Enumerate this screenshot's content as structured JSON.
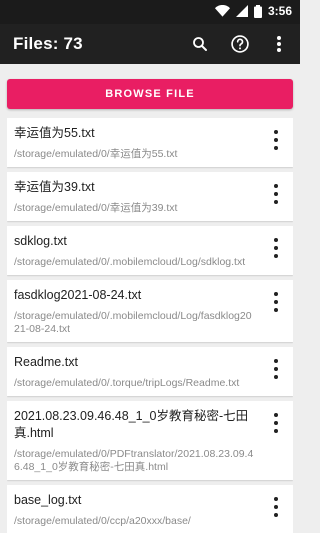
{
  "status": {
    "time": "3:56"
  },
  "appbar": {
    "title": "Files: 73",
    "icons": [
      "search-icon",
      "help-icon",
      "more-vert-icon"
    ]
  },
  "browse_button": {
    "label": "BROWSE FILE"
  },
  "files": [
    {
      "name": "幸运值为55.txt",
      "path": "/storage/emulated/0/幸运值为55.txt"
    },
    {
      "name": "幸运值为39.txt",
      "path": "/storage/emulated/0/幸运值为39.txt"
    },
    {
      "name": "sdklog.txt",
      "path": "/storage/emulated/0/.mobilemcloud/Log/sdklog.txt"
    },
    {
      "name": "fasdklog2021-08-24.txt",
      "path": "/storage/emulated/0/.mobilemcloud/Log/fasdklog2021-08-24.txt"
    },
    {
      "name": "Readme.txt",
      "path": "/storage/emulated/0/.torque/tripLogs/Readme.txt"
    },
    {
      "name": "2021.08.23.09.46.48_1_0岁教育秘密-七田真.html",
      "path": "/storage/emulated/0/PDFtranslator/2021.08.23.09.46.48_1_0岁教育秘密-七田真.html"
    },
    {
      "name": "base_log.txt",
      "path": "/storage/emulated/0/ссp/a20xxx/base/"
    }
  ],
  "colors": {
    "accent": "#e91e63",
    "appbar": "#212121",
    "statusbar": "#1b1b1b",
    "background": "#eeeeee"
  }
}
